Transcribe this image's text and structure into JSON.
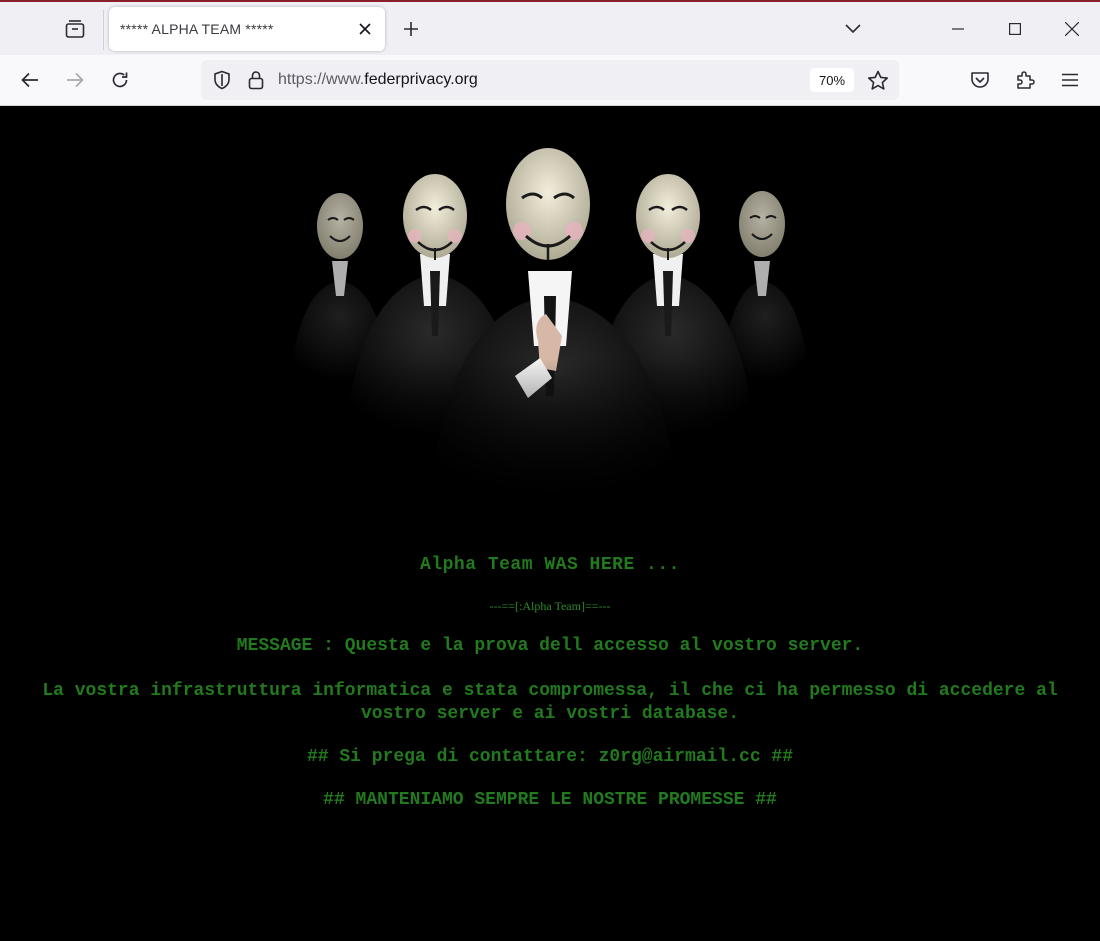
{
  "browser": {
    "tab_title": "***** ALPHA TEAM *****",
    "url_prefix": "https://www.",
    "url_domain": "federprivacy.org",
    "zoom": "70%"
  },
  "icons": {
    "tab_list": "tab-list-icon",
    "close_tab": "close-icon",
    "new_tab": "plus-icon",
    "list_all_tabs": "chevron-down-icon",
    "minimize": "minimize-icon",
    "maximize": "maximize-icon",
    "close_window": "close-icon",
    "back": "arrow-left-icon",
    "forward": "arrow-right-icon",
    "reload": "reload-icon",
    "tracking_protection": "shield-icon",
    "secure": "lock-icon",
    "bookmark": "star-icon",
    "pocket": "pocket-icon",
    "extensions": "puzzle-icon",
    "app_menu": "hamburger-menu-icon"
  },
  "colors": {
    "message_green": "#227a1e",
    "page_background": "#000000",
    "tab_accent": "#8a1f2a"
  },
  "page": {
    "image": "five-masked-figures-in-suits",
    "headline": "Alpha Team WAS HERE ...",
    "signature": "---==[:Alpha Team]==---",
    "message": "MESSAGE : Questa e la prova dell accesso al vostro server.",
    "infrastructure": "La vostra infrastruttura informatica e stata compromessa, il che ci ha permesso di accedere al vostro server e ai vostri database.",
    "contact": "## Si prega di contattare: z0rg@airmail.cc ##",
    "promise": "## MANTENIAMO SEMPRE LE NOSTRE PROMESSE ##"
  }
}
